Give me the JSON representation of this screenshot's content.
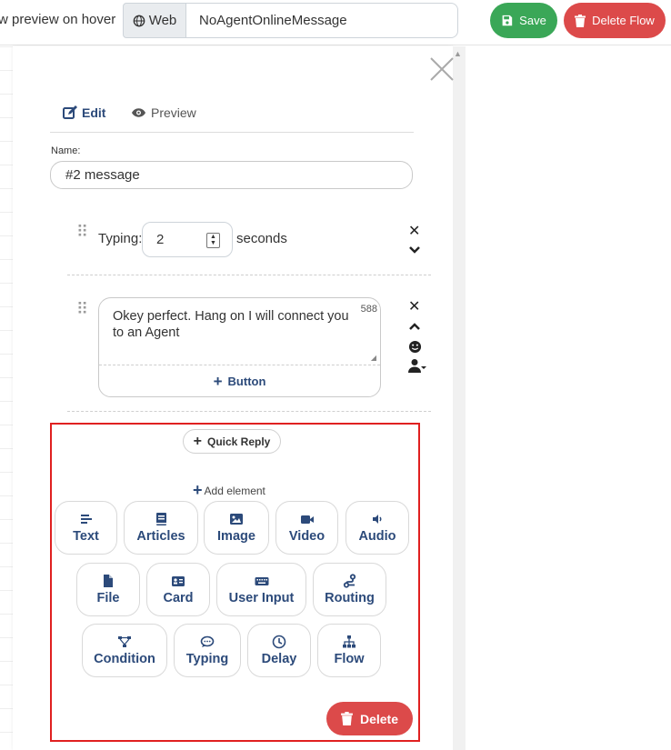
{
  "toolbar": {
    "hover_text": "w preview on hover",
    "channel_label": "Web",
    "flow_name": "NoAgentOnlineMessage",
    "save_label": "Save",
    "delete_flow_label": "Delete Flow"
  },
  "editor": {
    "tabs": {
      "edit": "Edit",
      "preview": "Preview"
    },
    "name_label": "Name:",
    "name_value": "#2 message",
    "typing": {
      "label": "Typing:",
      "value": "2",
      "unit": "seconds"
    },
    "message": {
      "text": "Okey perfect. Hang on I will connect you to an Agent",
      "char_count": "588",
      "button_label": "Button"
    },
    "quick_reply_label": "Quick Reply",
    "add_element_label": "Add element",
    "elements": [
      {
        "label": "Text",
        "icon": "text-icon"
      },
      {
        "label": "Articles",
        "icon": "book-icon"
      },
      {
        "label": "Image",
        "icon": "image-icon"
      },
      {
        "label": "Video",
        "icon": "video-icon"
      },
      {
        "label": "Audio",
        "icon": "volume-icon"
      },
      {
        "label": "File",
        "icon": "file-icon"
      },
      {
        "label": "Card",
        "icon": "id-card-icon"
      },
      {
        "label": "User Input",
        "icon": "keyboard-icon"
      },
      {
        "label": "Routing",
        "icon": "route-icon"
      },
      {
        "label": "Condition",
        "icon": "condition-icon"
      },
      {
        "label": "Typing",
        "icon": "comment-dots-icon"
      },
      {
        "label": "Delay",
        "icon": "clock-icon"
      },
      {
        "label": "Flow",
        "icon": "sitemap-icon"
      }
    ],
    "delete_label": "Delete"
  },
  "colors": {
    "accent": "#2c4a7a",
    "save": "#3aa757",
    "danger": "#dc4a4a",
    "highlight": "#e02020"
  }
}
